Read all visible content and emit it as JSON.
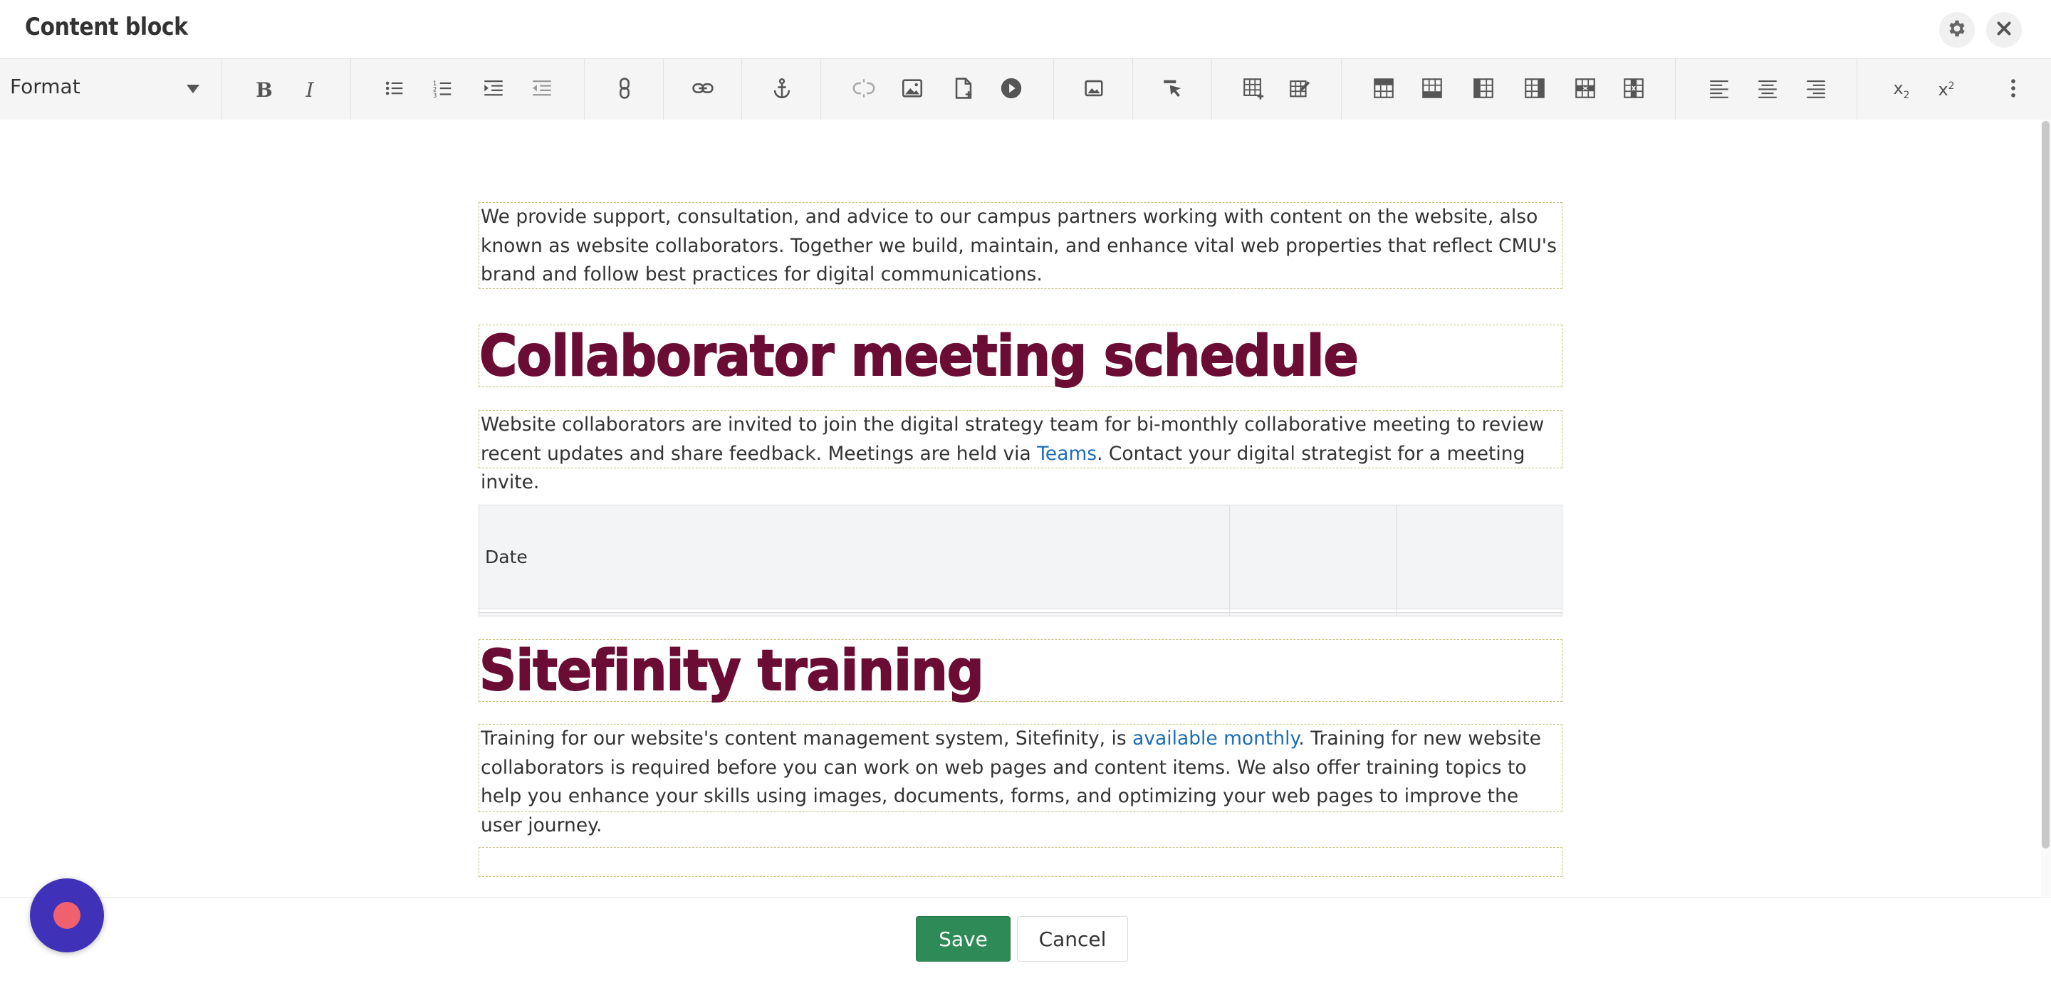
{
  "header": {
    "title": "Content block",
    "settings_icon": "gear-icon",
    "close_icon": "close-icon"
  },
  "toolbar": {
    "format_label": "Format",
    "buttons": [
      {
        "name": "bold",
        "icon": "bold-icon"
      },
      {
        "name": "italic",
        "icon": "italic-icon"
      },
      {
        "name": "bulleted-list",
        "icon": "bulleted-list-icon"
      },
      {
        "name": "numbered-list",
        "icon": "numbered-list-icon"
      },
      {
        "name": "indent",
        "icon": "indent-icon"
      },
      {
        "name": "outdent",
        "icon": "outdent-icon"
      },
      {
        "name": "link-manager",
        "icon": "link-manager-icon"
      },
      {
        "name": "insert-link",
        "icon": "link-icon"
      },
      {
        "name": "anchor",
        "icon": "anchor-icon"
      },
      {
        "name": "unlink",
        "icon": "unlink-icon"
      },
      {
        "name": "insert-image",
        "icon": "image-icon"
      },
      {
        "name": "insert-document",
        "icon": "document-icon"
      },
      {
        "name": "insert-video",
        "icon": "video-play-icon"
      },
      {
        "name": "image-gallery",
        "icon": "image-gallery-icon"
      },
      {
        "name": "format-painter",
        "icon": "format-painter-icon"
      },
      {
        "name": "insert-table",
        "icon": "table-insert-icon"
      },
      {
        "name": "table-properties",
        "icon": "table-edit-icon"
      },
      {
        "name": "insert-row-above",
        "icon": "row-above-icon"
      },
      {
        "name": "insert-row-below",
        "icon": "row-below-icon"
      },
      {
        "name": "insert-column-left",
        "icon": "column-left-icon"
      },
      {
        "name": "insert-column-right",
        "icon": "column-right-icon"
      },
      {
        "name": "delete-row",
        "icon": "delete-row-icon"
      },
      {
        "name": "delete-column",
        "icon": "delete-column-icon"
      },
      {
        "name": "align-left",
        "icon": "align-left-icon"
      },
      {
        "name": "align-center",
        "icon": "align-center-icon"
      },
      {
        "name": "align-right",
        "icon": "align-right-icon"
      },
      {
        "name": "subscript",
        "icon": "subscript-icon"
      },
      {
        "name": "superscript",
        "icon": "superscript-icon"
      },
      {
        "name": "more-options",
        "icon": "more-vertical-icon"
      }
    ]
  },
  "content": {
    "intro_paragraph": "We provide support, consultation, and advice to our campus partners working with content on the website, also known as website collaborators. Together we build, maintain, and enhance vital web properties that reflect CMU's brand and follow best practices for digital communications.",
    "heading_meetings": "Collaborator meeting schedule",
    "meetings_text_before": "Website collaborators are invited to join the digital strategy team for bi-monthly collaborative meeting to review recent updates and share feedback. Meetings are held via ",
    "meetings_link": "Teams",
    "meetings_text_after": ". Contact your digital strategist for a meeting invite.",
    "table": {
      "rows": [
        [
          "Date",
          "",
          ""
        ],
        [
          "",
          "",
          ""
        ],
        [
          "",
          "",
          ""
        ]
      ]
    },
    "heading_training": "Sitefinity training",
    "training_text_before": "Training for our website's content management system, Sitefinity, is ",
    "training_link": "available monthly",
    "training_text_after": ". Training for new website collaborators is required before you can work on web pages and content items. We also offer training topics to help you enhance your skills using images, documents, forms, and optimizing your web pages to improve the user journey."
  },
  "footer": {
    "save_label": "Save",
    "cancel_label": "Cancel"
  },
  "colors": {
    "heading": "#6b0c34",
    "link": "#1d6db8",
    "save_button": "#2e8a56",
    "record_button": "#3f32b8",
    "record_dot": "#f0606e"
  }
}
